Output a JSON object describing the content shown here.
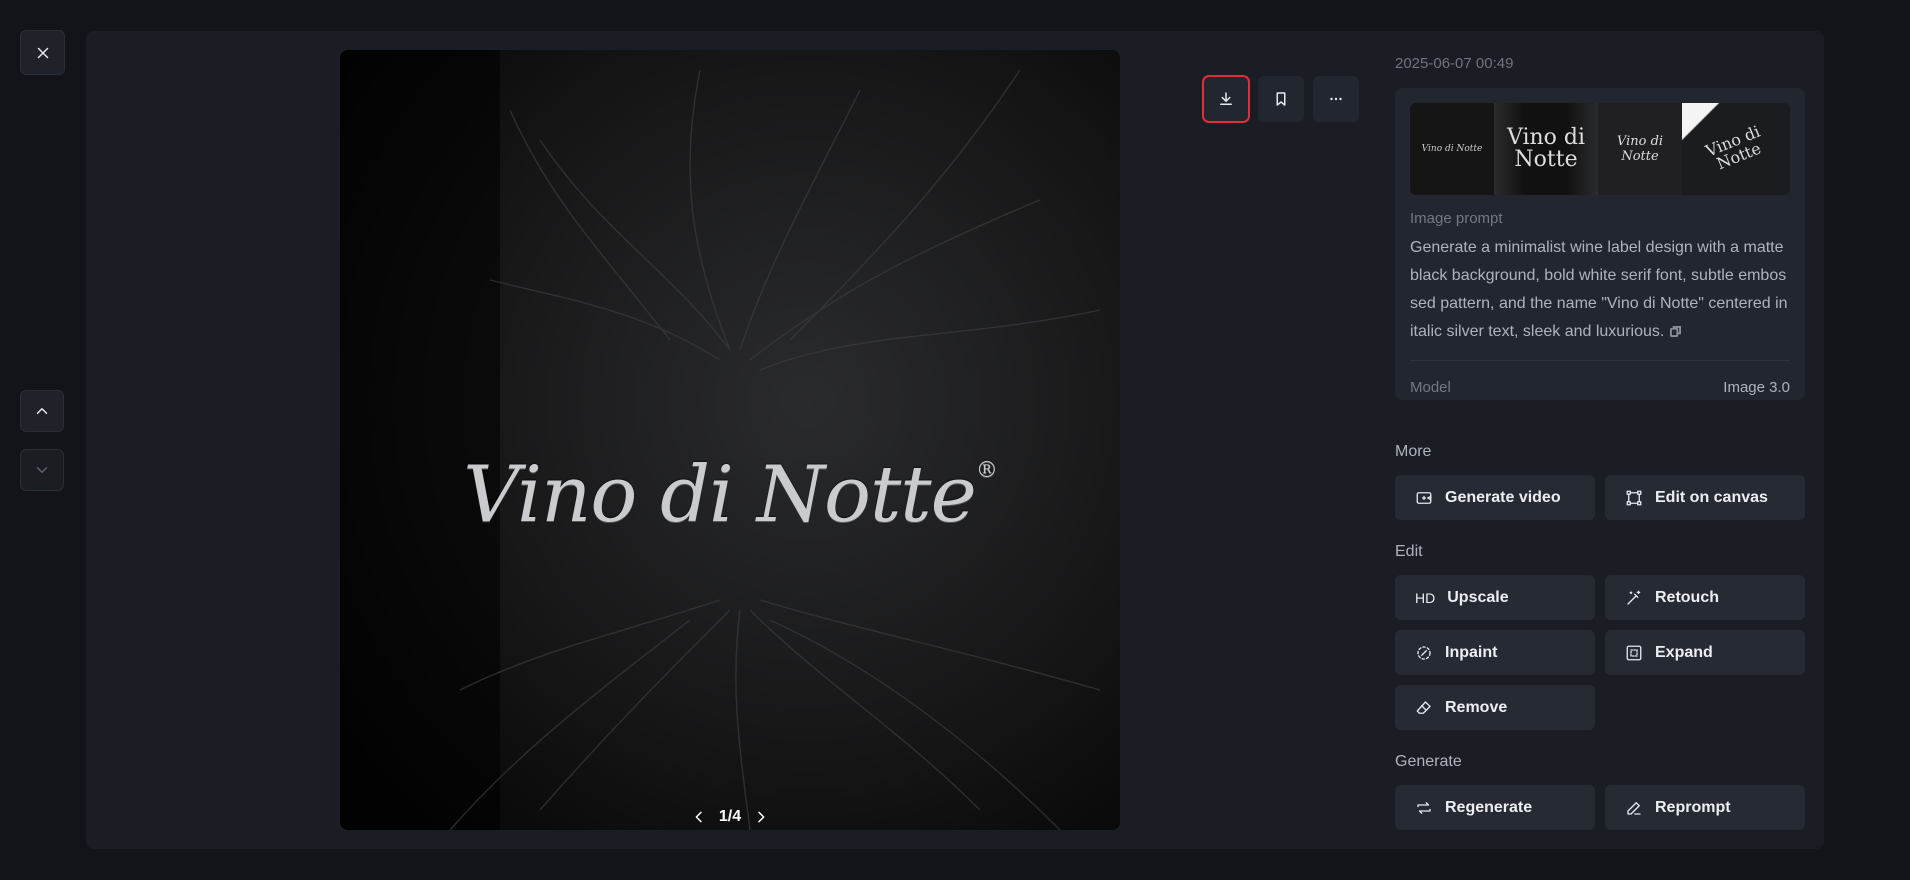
{
  "viewer": {
    "pager": {
      "current_of_total": "1/4"
    },
    "image_label": {
      "name": "Vino di Notte",
      "mark": "®"
    }
  },
  "sidebar": {
    "timestamp": "2025-06-07 00:49",
    "thumbnails": [
      {
        "text": "Vino di Notte"
      },
      {
        "text": "Vino di Notte"
      },
      {
        "text": "Vino di Notte"
      },
      {
        "text": "Vino di Notte"
      }
    ],
    "prompt_label": "Image prompt",
    "prompt_text": "Generate a minimalist wine label design with a matte black background, bold white serif font, subtle embossed pattern, and the name \"Vino di Notte\" centered in italic silver text, sleek and luxurious.",
    "model_label": "Model",
    "model_value": "Image 3.0",
    "more_title": "More",
    "more_actions": {
      "generate_video": "Generate video",
      "edit_on_canvas": "Edit on canvas"
    },
    "edit_title": "Edit",
    "edit_actions": {
      "upscale_prefix": "HD",
      "upscale": "Upscale",
      "retouch": "Retouch",
      "inpaint": "Inpaint",
      "expand": "Expand",
      "remove": "Remove"
    },
    "generate_title": "Generate",
    "generate_actions": {
      "regenerate": "Regenerate",
      "reprompt": "Reprompt"
    }
  },
  "colors": {
    "highlight_outline": "#e02e3a",
    "panel": "#1a1d24",
    "background": "#121419"
  }
}
